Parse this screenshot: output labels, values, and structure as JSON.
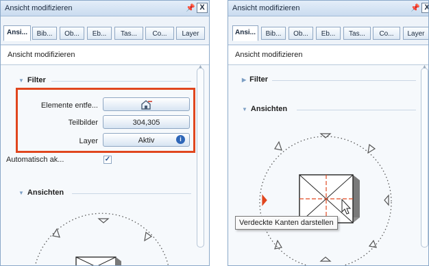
{
  "colors": {
    "accent_frame": "#e0461e",
    "title_bar": "#c9dbef",
    "marker": "#e0461e"
  },
  "left_panel": {
    "title": "Ansicht modifizieren",
    "pin_icon": "pin-icon",
    "close_label": "X",
    "tabs": [
      "Ansi...",
      "Bib...",
      "Ob...",
      "Eb...",
      "Tas...",
      "Co...",
      "Layer"
    ],
    "subheading": "Ansicht modifizieren",
    "filter": {
      "heading": "Filter",
      "rows": [
        {
          "label": "Elemente entfe...",
          "value": "",
          "icon": "remove-element-icon"
        },
        {
          "label": "Teilbilder",
          "value": "304,305"
        },
        {
          "label": "Layer",
          "value": "Aktiv",
          "icon": "info-icon"
        }
      ],
      "auto_label": "Automatisch ak...",
      "auto_checked": true
    },
    "ansichten_heading": "Ansichten"
  },
  "right_panel": {
    "title": "Ansicht modifizieren",
    "pin_icon": "pin-icon",
    "close_label": "X",
    "tabs": [
      "Ansi...",
      "Bib...",
      "Ob...",
      "Eb...",
      "Tas...",
      "Co...",
      "Layer"
    ],
    "subheading": "Ansicht modifizieren",
    "filter_heading": "Filter",
    "ansichten_heading": "Ansichten",
    "tooltip": "Verdeckte Kanten darstellen"
  }
}
